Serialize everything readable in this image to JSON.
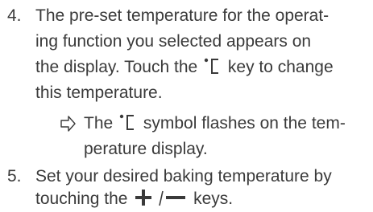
{
  "step4": {
    "number": "4.",
    "line1": "The pre-set temperature for the operat-",
    "line2": "ing function you selected appears on",
    "line3": "the display. Touch the",
    "line3_icon": "degree-celsius-icon",
    "line3_after": "key to change",
    "line4": "this temperature.",
    "result": {
      "icon": "result-arrow-icon",
      "line1_before": "The",
      "line1_icon": "degree-celsius-icon",
      "line1_after": "symbol flashes on the tem-",
      "line2": "perature display."
    }
  },
  "step5": {
    "number": "5.",
    "line1": "Set your desired baking temperature by",
    "line2_before": "touching the",
    "line2_icon": "plus-minus-keys-icon",
    "line2_after": "keys."
  }
}
